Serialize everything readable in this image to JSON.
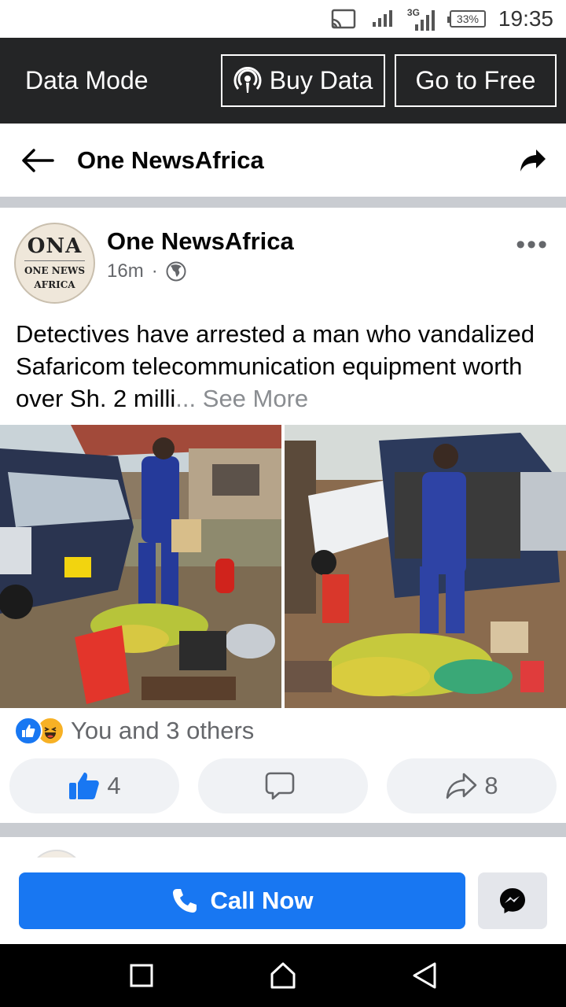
{
  "status": {
    "network_label": "3G",
    "battery": "33%",
    "time": "19:35"
  },
  "data_bar": {
    "title": "Data Mode",
    "buy_label": "Buy Data",
    "free_label": "Go to Free"
  },
  "header": {
    "page_name": "One NewsAfrica"
  },
  "post": {
    "avatar_big": "ONA",
    "avatar_small_1": "ONE NEWS",
    "avatar_small_2": "AFRICA",
    "author": "One NewsAfrica",
    "time": "16m",
    "dot": "·",
    "more": "•••",
    "text": "Detectives have arrested a man who vandalized Safaricom telecommunication equipment worth over Sh. 2 milli",
    "ellipsis": "...",
    "see_more": "See More",
    "reaction_text": "You and 3 others",
    "like_count": "4",
    "share_count": "8"
  },
  "cta": {
    "call_label": "Call Now"
  },
  "colors": {
    "brand_blue": "#1877f2",
    "dark_bar": "#242526",
    "divider": "#c9ccd1",
    "muted_text": "#65676b"
  }
}
